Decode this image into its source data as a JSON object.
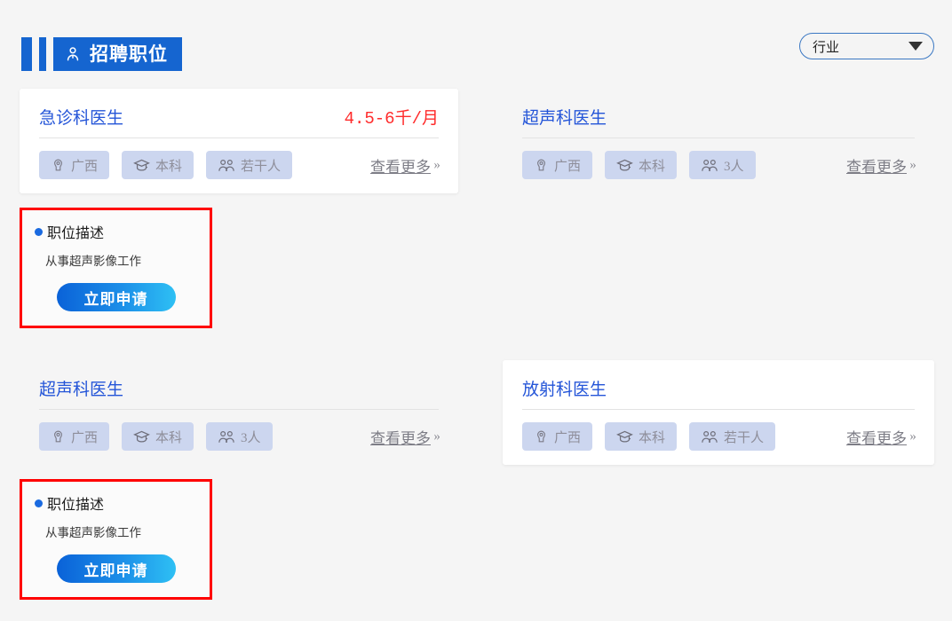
{
  "header": {
    "banner_title": "招聘职位",
    "banner_icon": "person-icon",
    "banner_color": "#1565d0"
  },
  "industry_filter": {
    "label": "行业",
    "icon": "chevron-down-icon",
    "border_color": "#3b78c3"
  },
  "tag_icons": {
    "location": "location-pin-icon",
    "education": "graduation-cap-icon",
    "headcount": "people-icon"
  },
  "more_link": {
    "text": "查看更多",
    "chevrons": "››"
  },
  "jobs": [
    {
      "title": "急诊科医生",
      "salary": "4.5-6千/月",
      "location": "广西",
      "education": "本科",
      "headcount": "若干人",
      "card_style": "filled"
    },
    {
      "title": "超声科医生",
      "salary": "",
      "location": "广西",
      "education": "本科",
      "headcount": "3人",
      "card_style": "plain"
    },
    {
      "title": "超声科医生",
      "salary": "",
      "location": "广西",
      "education": "本科",
      "headcount": "3人",
      "card_style": "plain"
    },
    {
      "title": "放射科医生",
      "salary": "",
      "location": "广西",
      "education": "本科",
      "headcount": "若干人",
      "card_style": "filled"
    }
  ],
  "description_panels": [
    {
      "heading": "职位描述",
      "body": "从事超声影像工作",
      "apply_label": "立即申请",
      "border_color": "#ff0000"
    },
    {
      "heading": "职位描述",
      "body": "从事超声影像工作",
      "apply_label": "立即申请",
      "border_color": "#ff0000"
    }
  ]
}
